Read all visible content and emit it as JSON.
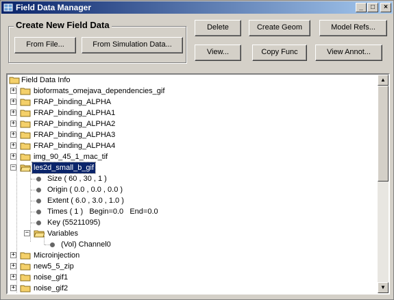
{
  "window": {
    "title": "Field Data Manager",
    "minimize": "_",
    "maximize": "□",
    "close": "×"
  },
  "create_group": {
    "title": "Create New Field Data",
    "from_file": "From File...",
    "from_simulation": "From Simulation Data..."
  },
  "actions": {
    "delete": "Delete",
    "create_geom": "Create Geom",
    "model_refs": "Model Refs...",
    "view": "View...",
    "copy_func": "Copy Func",
    "view_annot": "View Annot..."
  },
  "tree": {
    "root": "Field Data Info",
    "items_before": [
      "bioformats_omejava_dependencies_gif",
      "FRAP_binding_ALPHA",
      "FRAP_binding_ALPHA1",
      "FRAP_binding_ALPHA2",
      "FRAP_binding_ALPHA3",
      "FRAP_binding_ALPHA4",
      "img_90_45_1_mac_tif"
    ],
    "selected": "les2d_small_b_gif",
    "details": [
      "Size ( 60 , 30 , 1 )",
      "Origin ( 0.0 , 0.0 , 0.0 )",
      "Extent ( 6.0 , 3.0 , 1.0 )",
      "Times ( 1 )   Begin=0.0   End=0.0",
      "Key (55211095)"
    ],
    "variables_label": "Variables",
    "variable": "(Vol) Channel0",
    "items_after": [
      "Microinjection",
      "new5_5_zip",
      "noise_gif1",
      "noise_gif2"
    ]
  },
  "icons": {
    "folder": "folder-icon",
    "bullet": "bullet-icon",
    "app": "field-data-app-icon"
  },
  "colors": {
    "titlebar_start": "#0a246a",
    "titlebar_end": "#a6caf0",
    "selection": "#0a246a",
    "folder": "#f4d06a"
  }
}
